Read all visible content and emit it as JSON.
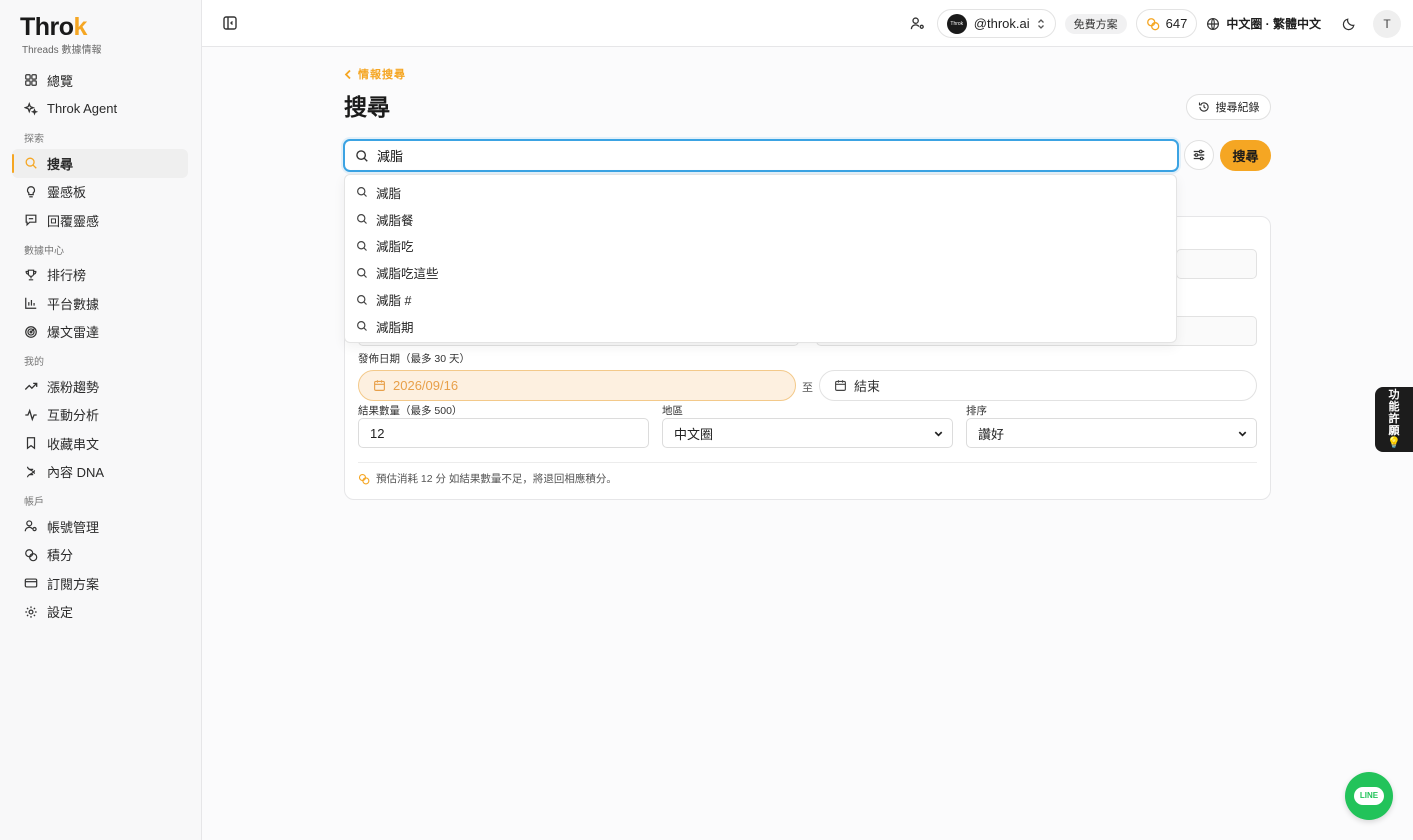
{
  "app": {
    "logo_text": "Throk",
    "logo_sub": "Threads 數據情報"
  },
  "sidebar": {
    "items_top": [
      {
        "label": "總覽",
        "icon": "grid-icon"
      },
      {
        "label": "Throk Agent",
        "icon": "sparkle-icon"
      }
    ],
    "section_explore": "探索",
    "items_explore": [
      {
        "label": "搜尋",
        "icon": "search-icon",
        "active": true
      },
      {
        "label": "靈感板",
        "icon": "lightbulb-icon"
      },
      {
        "label": "回覆靈感",
        "icon": "reply-icon"
      }
    ],
    "section_data": "數據中心",
    "items_data": [
      {
        "label": "排行榜",
        "icon": "trophy-icon"
      },
      {
        "label": "平台數據",
        "icon": "bar-chart-icon"
      },
      {
        "label": "爆文雷達",
        "icon": "radar-icon"
      }
    ],
    "section_mine": "我的",
    "items_mine": [
      {
        "label": "漲粉趨勢",
        "icon": "trend-up-icon"
      },
      {
        "label": "互動分析",
        "icon": "activity-icon"
      },
      {
        "label": "收藏串文",
        "icon": "bookmark-icon"
      },
      {
        "label": "內容 DNA",
        "icon": "dna-icon"
      }
    ],
    "section_account": "帳戶",
    "items_account": [
      {
        "label": "帳號管理",
        "icon": "user-cog-icon"
      },
      {
        "label": "積分",
        "icon": "coins-icon"
      },
      {
        "label": "訂閱方案",
        "icon": "credit-card-icon"
      },
      {
        "label": "設定",
        "icon": "gear-icon"
      }
    ]
  },
  "topbar": {
    "account_handle": "@throk.ai",
    "account_avatar_text": "Throk",
    "plan": "免費方案",
    "credits": "647",
    "language": "中文圈 · 繁體中文",
    "user_initial": "T"
  },
  "main": {
    "breadcrumb": "情報搜尋",
    "title": "搜尋",
    "history_label": "搜尋紀錄",
    "search_value": "減脂",
    "search_button": "搜尋",
    "suggestions": [
      "減脂",
      "減脂餐",
      "減脂吃",
      "減脂吃這些",
      "減脂 #",
      "減脂期"
    ],
    "date_label": "發佈日期（最多 30 天）",
    "date_start": "2026/09/16",
    "date_to": "至",
    "date_end_placeholder": "結束",
    "count_label": "結果數量（最多 500）",
    "count_value": "12",
    "region_label": "地區",
    "region_value": "中文圈",
    "sort_label": "排序",
    "sort_value": "讚好",
    "note": "預估消耗 12 分 如結果數量不足，將退回相應積分。"
  },
  "feedback": {
    "chars": [
      "功",
      "能",
      "許",
      "願"
    ]
  },
  "line_button": {
    "label": "LINE"
  },
  "colors": {
    "accent": "#f5a623",
    "focus": "#3ba3e3",
    "line_green": "#22c35a"
  }
}
